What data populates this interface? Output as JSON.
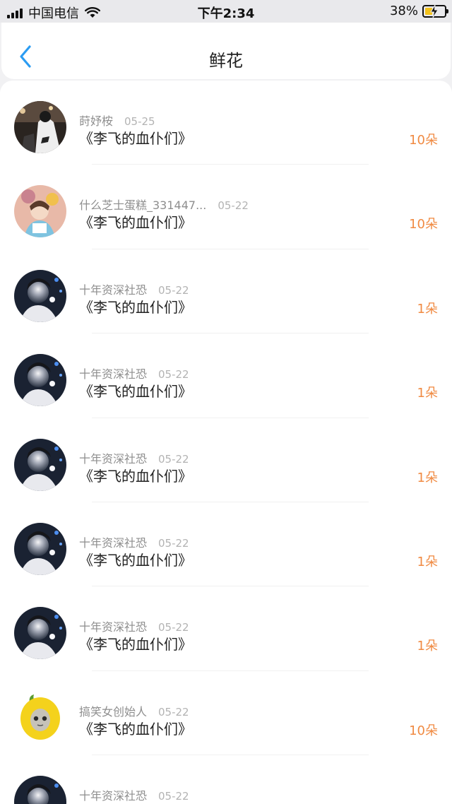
{
  "status": {
    "carrier": "中国电信",
    "time": "下午2:34",
    "battery": "38%"
  },
  "nav": {
    "title": "鲜花"
  },
  "rows": [
    {
      "name": "莳妤桉",
      "date": "05-25",
      "book": "《李飞的血仆们》",
      "count": "10朵"
    },
    {
      "name": "什么芝士蛋糕_331447...",
      "date": "05-22",
      "book": "《李飞的血仆们》",
      "count": "10朵"
    },
    {
      "name": "十年资深社恐",
      "date": "05-22",
      "book": "《李飞的血仆们》",
      "count": "1朵"
    },
    {
      "name": "十年资深社恐",
      "date": "05-22",
      "book": "《李飞的血仆们》",
      "count": "1朵"
    },
    {
      "name": "十年资深社恐",
      "date": "05-22",
      "book": "《李飞的血仆们》",
      "count": "1朵"
    },
    {
      "name": "十年资深社恐",
      "date": "05-22",
      "book": "《李飞的血仆们》",
      "count": "1朵"
    },
    {
      "name": "十年资深社恐",
      "date": "05-22",
      "book": "《李飞的血仆们》",
      "count": "1朵"
    },
    {
      "name": "搞笑女创始人",
      "date": "05-22",
      "book": "《李飞的血仆们》",
      "count": "10朵"
    },
    {
      "name": "十年资深社恐",
      "date": "05-22",
      "book": "",
      "count": ""
    }
  ]
}
